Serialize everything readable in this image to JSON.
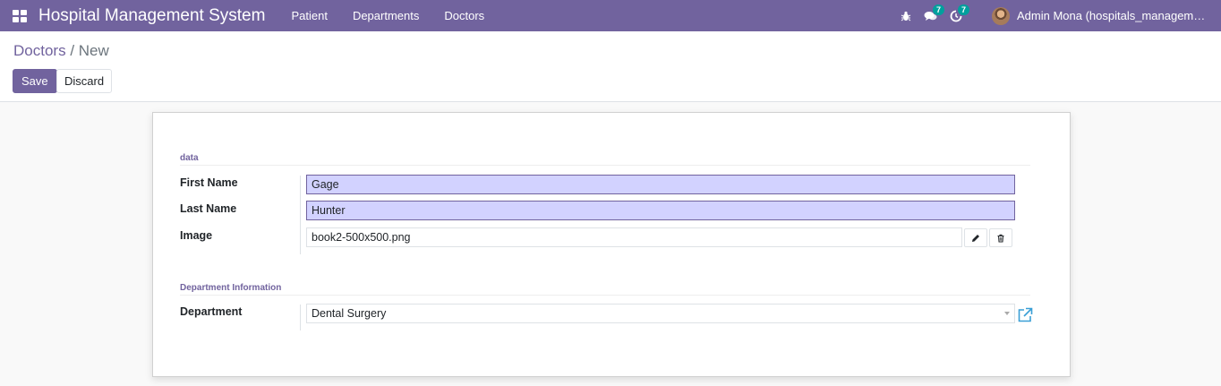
{
  "navbar": {
    "app_title": "Hospital Management System",
    "menu": [
      "Patient",
      "Departments",
      "Doctors"
    ],
    "messages_count": "7",
    "activities_count": "7",
    "user_name": "Admin Mona (hospitals_management_...",
    "bg_color": "#71639e"
  },
  "breadcrumb": {
    "parent": "Doctors",
    "separator": "/",
    "current": "New"
  },
  "actions": {
    "save_label": "Save",
    "discard_label": "Discard"
  },
  "form": {
    "section_data": "data",
    "first_name_label": "First Name",
    "first_name_value": "Gage",
    "last_name_label": "Last Name",
    "last_name_value": "Hunter",
    "image_label": "Image",
    "image_value": "book2-500x500.png",
    "section_department": "Department Information",
    "department_label": "Department",
    "department_value": "Dental Surgery"
  },
  "icons": [
    "apps-grid-icon",
    "bug-icon",
    "chat-icon",
    "clock-icon",
    "pencil-icon",
    "trash-icon",
    "chevron-down-icon",
    "external-link-icon"
  ]
}
